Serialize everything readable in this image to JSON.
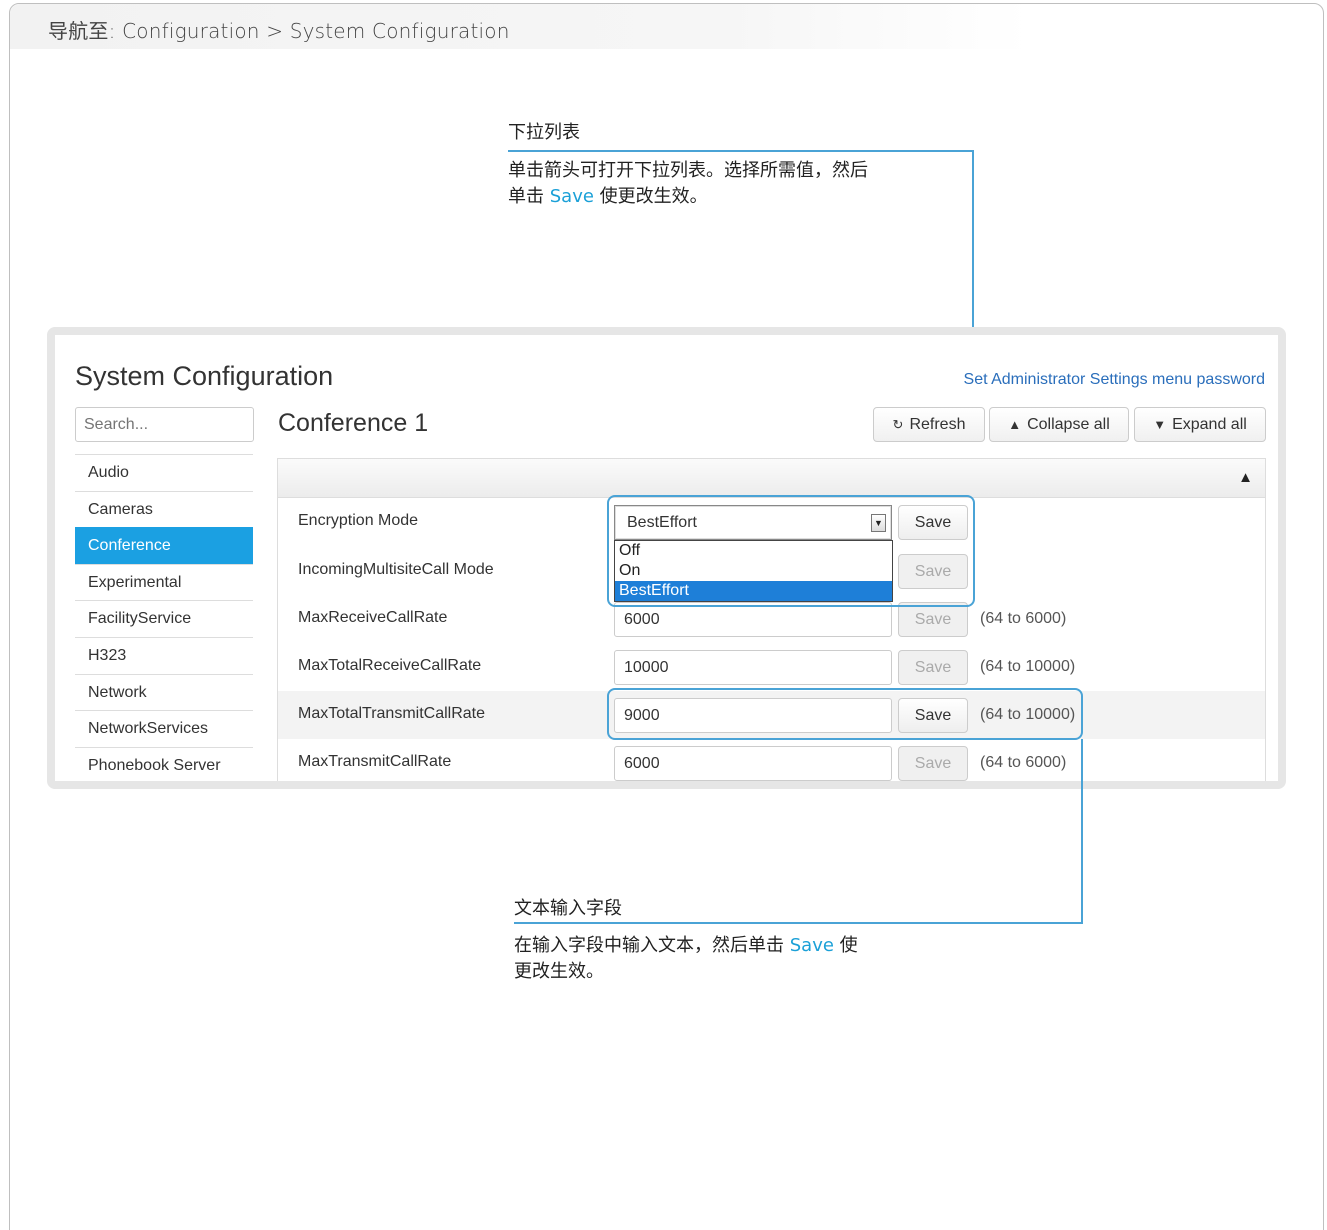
{
  "nav": {
    "text": "导航至: Configuration > System Configuration"
  },
  "callout_dropdown": {
    "title": "下拉列表",
    "body_line1": "单击箭头可打开下拉列表。选择所需值，然后",
    "body_line2_pre": "单击 ",
    "body_line2_hl": "Save",
    "body_line2_post": " 使更改生效。"
  },
  "callout_text": {
    "title": "文本输入字段",
    "body_line1_pre": "在输入字段中输入文本，然后单击 ",
    "body_line1_hl": "Save",
    "body_line1_post": " 使",
    "body_line2": "更改生效。"
  },
  "panel": {
    "title": "System Configuration",
    "admin_link": "Set Administrator Settings menu password",
    "search_placeholder": "Search...",
    "section_title": "Conference 1",
    "buttons": {
      "refresh": "Refresh",
      "collapse": "Collapse all",
      "expand": "Expand all"
    },
    "sidebar": [
      {
        "label": "Audio"
      },
      {
        "label": "Cameras"
      },
      {
        "label": "Conference",
        "active": true
      },
      {
        "label": "Experimental"
      },
      {
        "label": "FacilityService"
      },
      {
        "label": "H323"
      },
      {
        "label": "Network"
      },
      {
        "label": "NetworkServices"
      },
      {
        "label": "Phonebook Server"
      }
    ],
    "rows": [
      {
        "label": "Encryption Mode",
        "value": "BestEffort",
        "save": "Save",
        "range": ""
      },
      {
        "label": "IncomingMultisiteCall Mode",
        "value": "",
        "save": "Save",
        "range": ""
      },
      {
        "label": "MaxReceiveCallRate",
        "value": "6000",
        "save": "Save",
        "range": "(64 to 6000)"
      },
      {
        "label": "MaxTotalReceiveCallRate",
        "value": "10000",
        "save": "Save",
        "range": "(64 to 10000)"
      },
      {
        "label": "MaxTotalTransmitCallRate",
        "value": "9000",
        "save": "Save",
        "range": "(64 to 10000)"
      },
      {
        "label": "MaxTransmitCallRate",
        "value": "6000",
        "save": "Save",
        "range": "(64 to 6000)"
      }
    ],
    "dropdown_options": [
      "Off",
      "On",
      "BestEffort"
    ],
    "dropdown_selected": "BestEffort"
  },
  "colors": {
    "accent": "#1ba0e2",
    "callout": "#4aa3d6",
    "link": "#2a6ebb"
  }
}
